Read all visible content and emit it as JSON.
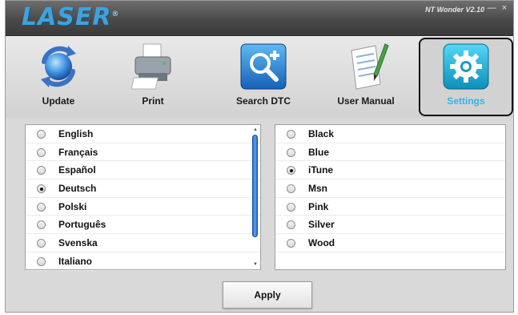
{
  "window": {
    "logo_text": "LASER",
    "logo_mark": "®",
    "version": "NT Wonder V2.10",
    "minimize_glyph": "—",
    "close_glyph": "×"
  },
  "toolbar": {
    "items": [
      {
        "label": "Update",
        "icon": "refresh-globe-icon"
      },
      {
        "label": "Print",
        "icon": "printer-icon"
      },
      {
        "label": "Search DTC",
        "icon": "magnifier-plus-icon"
      },
      {
        "label": "User Manual",
        "icon": "manual-pencil-icon"
      },
      {
        "label": "Settings",
        "icon": "gear-icon",
        "selected": true
      }
    ]
  },
  "languages": {
    "selected": "Deutsch",
    "options": [
      "English",
      "Français",
      "Español",
      "Deutsch",
      "Polski",
      "Português",
      "Svenska",
      "Italiano"
    ]
  },
  "skins": {
    "selected": "iTune",
    "options": [
      "Black",
      "Blue",
      "iTune",
      "Msn",
      "Pink",
      "Silver",
      "Wood"
    ]
  },
  "apply_label": "Apply",
  "colors": {
    "accent": "#33b4e6",
    "scrollbar": "#3b86e0",
    "titlebar": "#4a4a4a"
  }
}
